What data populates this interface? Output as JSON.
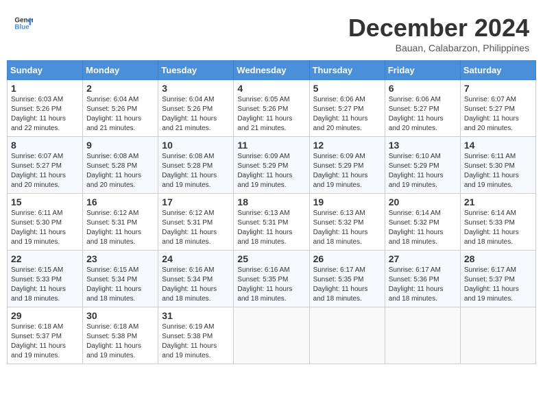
{
  "logo": {
    "line1": "General",
    "line2": "Blue"
  },
  "title": "December 2024",
  "subtitle": "Bauan, Calabarzon, Philippines",
  "days_header": [
    "Sunday",
    "Monday",
    "Tuesday",
    "Wednesday",
    "Thursday",
    "Friday",
    "Saturday"
  ],
  "weeks": [
    [
      {
        "day": "1",
        "info": "Sunrise: 6:03 AM\nSunset: 5:26 PM\nDaylight: 11 hours\nand 22 minutes."
      },
      {
        "day": "2",
        "info": "Sunrise: 6:04 AM\nSunset: 5:26 PM\nDaylight: 11 hours\nand 21 minutes."
      },
      {
        "day": "3",
        "info": "Sunrise: 6:04 AM\nSunset: 5:26 PM\nDaylight: 11 hours\nand 21 minutes."
      },
      {
        "day": "4",
        "info": "Sunrise: 6:05 AM\nSunset: 5:26 PM\nDaylight: 11 hours\nand 21 minutes."
      },
      {
        "day": "5",
        "info": "Sunrise: 6:06 AM\nSunset: 5:27 PM\nDaylight: 11 hours\nand 20 minutes."
      },
      {
        "day": "6",
        "info": "Sunrise: 6:06 AM\nSunset: 5:27 PM\nDaylight: 11 hours\nand 20 minutes."
      },
      {
        "day": "7",
        "info": "Sunrise: 6:07 AM\nSunset: 5:27 PM\nDaylight: 11 hours\nand 20 minutes."
      }
    ],
    [
      {
        "day": "8",
        "info": "Sunrise: 6:07 AM\nSunset: 5:27 PM\nDaylight: 11 hours\nand 20 minutes."
      },
      {
        "day": "9",
        "info": "Sunrise: 6:08 AM\nSunset: 5:28 PM\nDaylight: 11 hours\nand 20 minutes."
      },
      {
        "day": "10",
        "info": "Sunrise: 6:08 AM\nSunset: 5:28 PM\nDaylight: 11 hours\nand 19 minutes."
      },
      {
        "day": "11",
        "info": "Sunrise: 6:09 AM\nSunset: 5:29 PM\nDaylight: 11 hours\nand 19 minutes."
      },
      {
        "day": "12",
        "info": "Sunrise: 6:09 AM\nSunset: 5:29 PM\nDaylight: 11 hours\nand 19 minutes."
      },
      {
        "day": "13",
        "info": "Sunrise: 6:10 AM\nSunset: 5:29 PM\nDaylight: 11 hours\nand 19 minutes."
      },
      {
        "day": "14",
        "info": "Sunrise: 6:11 AM\nSunset: 5:30 PM\nDaylight: 11 hours\nand 19 minutes."
      }
    ],
    [
      {
        "day": "15",
        "info": "Sunrise: 6:11 AM\nSunset: 5:30 PM\nDaylight: 11 hours\nand 19 minutes."
      },
      {
        "day": "16",
        "info": "Sunrise: 6:12 AM\nSunset: 5:31 PM\nDaylight: 11 hours\nand 18 minutes."
      },
      {
        "day": "17",
        "info": "Sunrise: 6:12 AM\nSunset: 5:31 PM\nDaylight: 11 hours\nand 18 minutes."
      },
      {
        "day": "18",
        "info": "Sunrise: 6:13 AM\nSunset: 5:31 PM\nDaylight: 11 hours\nand 18 minutes."
      },
      {
        "day": "19",
        "info": "Sunrise: 6:13 AM\nSunset: 5:32 PM\nDaylight: 11 hours\nand 18 minutes."
      },
      {
        "day": "20",
        "info": "Sunrise: 6:14 AM\nSunset: 5:32 PM\nDaylight: 11 hours\nand 18 minutes."
      },
      {
        "day": "21",
        "info": "Sunrise: 6:14 AM\nSunset: 5:33 PM\nDaylight: 11 hours\nand 18 minutes."
      }
    ],
    [
      {
        "day": "22",
        "info": "Sunrise: 6:15 AM\nSunset: 5:33 PM\nDaylight: 11 hours\nand 18 minutes."
      },
      {
        "day": "23",
        "info": "Sunrise: 6:15 AM\nSunset: 5:34 PM\nDaylight: 11 hours\nand 18 minutes."
      },
      {
        "day": "24",
        "info": "Sunrise: 6:16 AM\nSunset: 5:34 PM\nDaylight: 11 hours\nand 18 minutes."
      },
      {
        "day": "25",
        "info": "Sunrise: 6:16 AM\nSunset: 5:35 PM\nDaylight: 11 hours\nand 18 minutes."
      },
      {
        "day": "26",
        "info": "Sunrise: 6:17 AM\nSunset: 5:35 PM\nDaylight: 11 hours\nand 18 minutes."
      },
      {
        "day": "27",
        "info": "Sunrise: 6:17 AM\nSunset: 5:36 PM\nDaylight: 11 hours\nand 18 minutes."
      },
      {
        "day": "28",
        "info": "Sunrise: 6:17 AM\nSunset: 5:37 PM\nDaylight: 11 hours\nand 19 minutes."
      }
    ],
    [
      {
        "day": "29",
        "info": "Sunrise: 6:18 AM\nSunset: 5:37 PM\nDaylight: 11 hours\nand 19 minutes."
      },
      {
        "day": "30",
        "info": "Sunrise: 6:18 AM\nSunset: 5:38 PM\nDaylight: 11 hours\nand 19 minutes."
      },
      {
        "day": "31",
        "info": "Sunrise: 6:19 AM\nSunset: 5:38 PM\nDaylight: 11 hours\nand 19 minutes."
      },
      {
        "day": "",
        "info": ""
      },
      {
        "day": "",
        "info": ""
      },
      {
        "day": "",
        "info": ""
      },
      {
        "day": "",
        "info": ""
      }
    ]
  ]
}
